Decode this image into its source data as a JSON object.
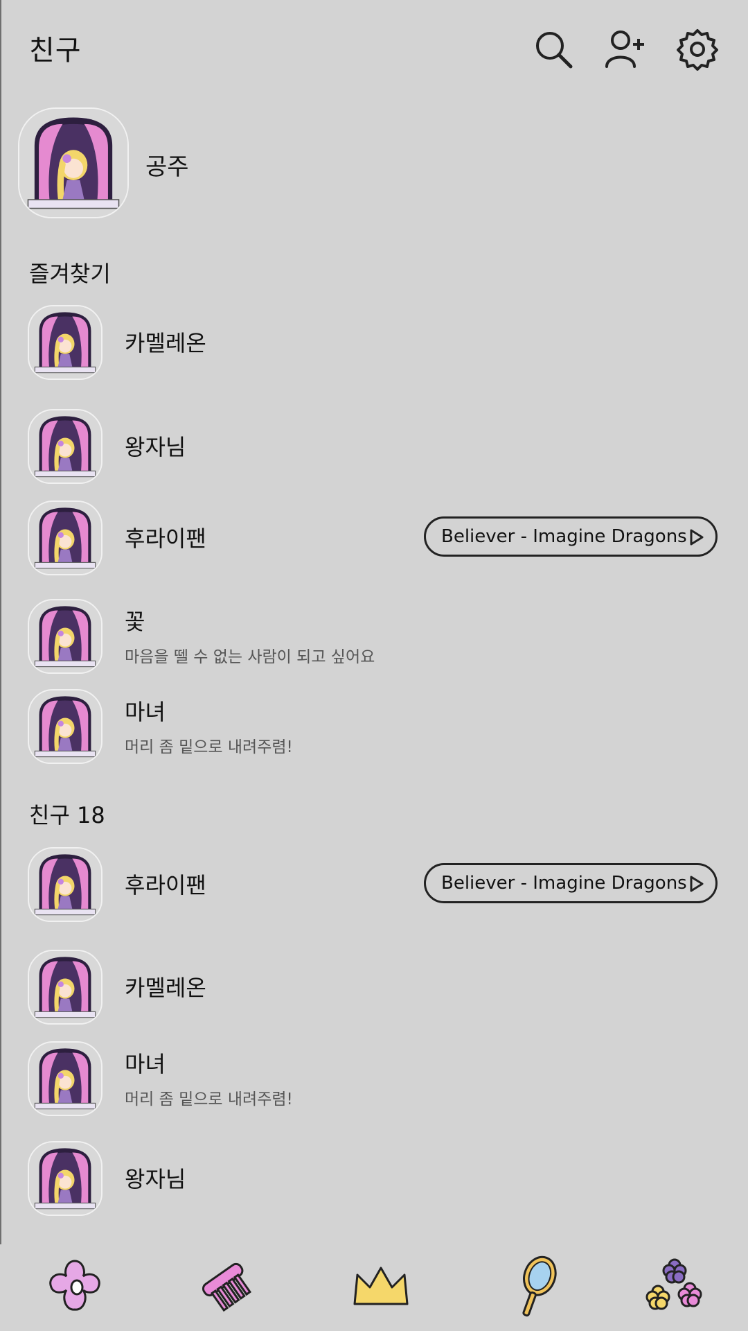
{
  "header": {
    "title": "친구"
  },
  "icons": {
    "search": "search-icon",
    "add_friend": "add-friend-icon",
    "settings": "gear-icon"
  },
  "my_profile": {
    "name": "공주"
  },
  "favorites": {
    "label": "즐겨찾기",
    "items": [
      {
        "name": "카멜레온"
      },
      {
        "name": "왕자님"
      },
      {
        "name": "후라이팬",
        "music": "Believer - Imagine Dragons"
      },
      {
        "name": "꽃",
        "status": "마음을 뗄 수 없는 사람이 되고 싶어요"
      },
      {
        "name": "마녀",
        "status": "머리 좀 밑으로 내려주렴!"
      }
    ]
  },
  "friends": {
    "label": "친구 18",
    "items": [
      {
        "name": "후라이팬",
        "music": "Believer - Imagine Dragons"
      },
      {
        "name": "카멜레온"
      },
      {
        "name": "마녀",
        "status": "머리 좀 밑으로 내려주렴!"
      },
      {
        "name": "왕자님"
      }
    ]
  },
  "nav": [
    "flower-icon",
    "comb-icon",
    "crown-icon",
    "mirror-icon",
    "flowers-icon"
  ],
  "colors": {
    "background": "#d3d3d3",
    "window_pink": "#e58ad0",
    "window_dark": "#4a3163",
    "hair_yellow": "#f3d66a",
    "nav_flower": "#e6a8e6",
    "nav_comb": "#e98bd8",
    "nav_crown": "#f5d76a",
    "nav_mirror_glass": "#a7d2ef"
  }
}
